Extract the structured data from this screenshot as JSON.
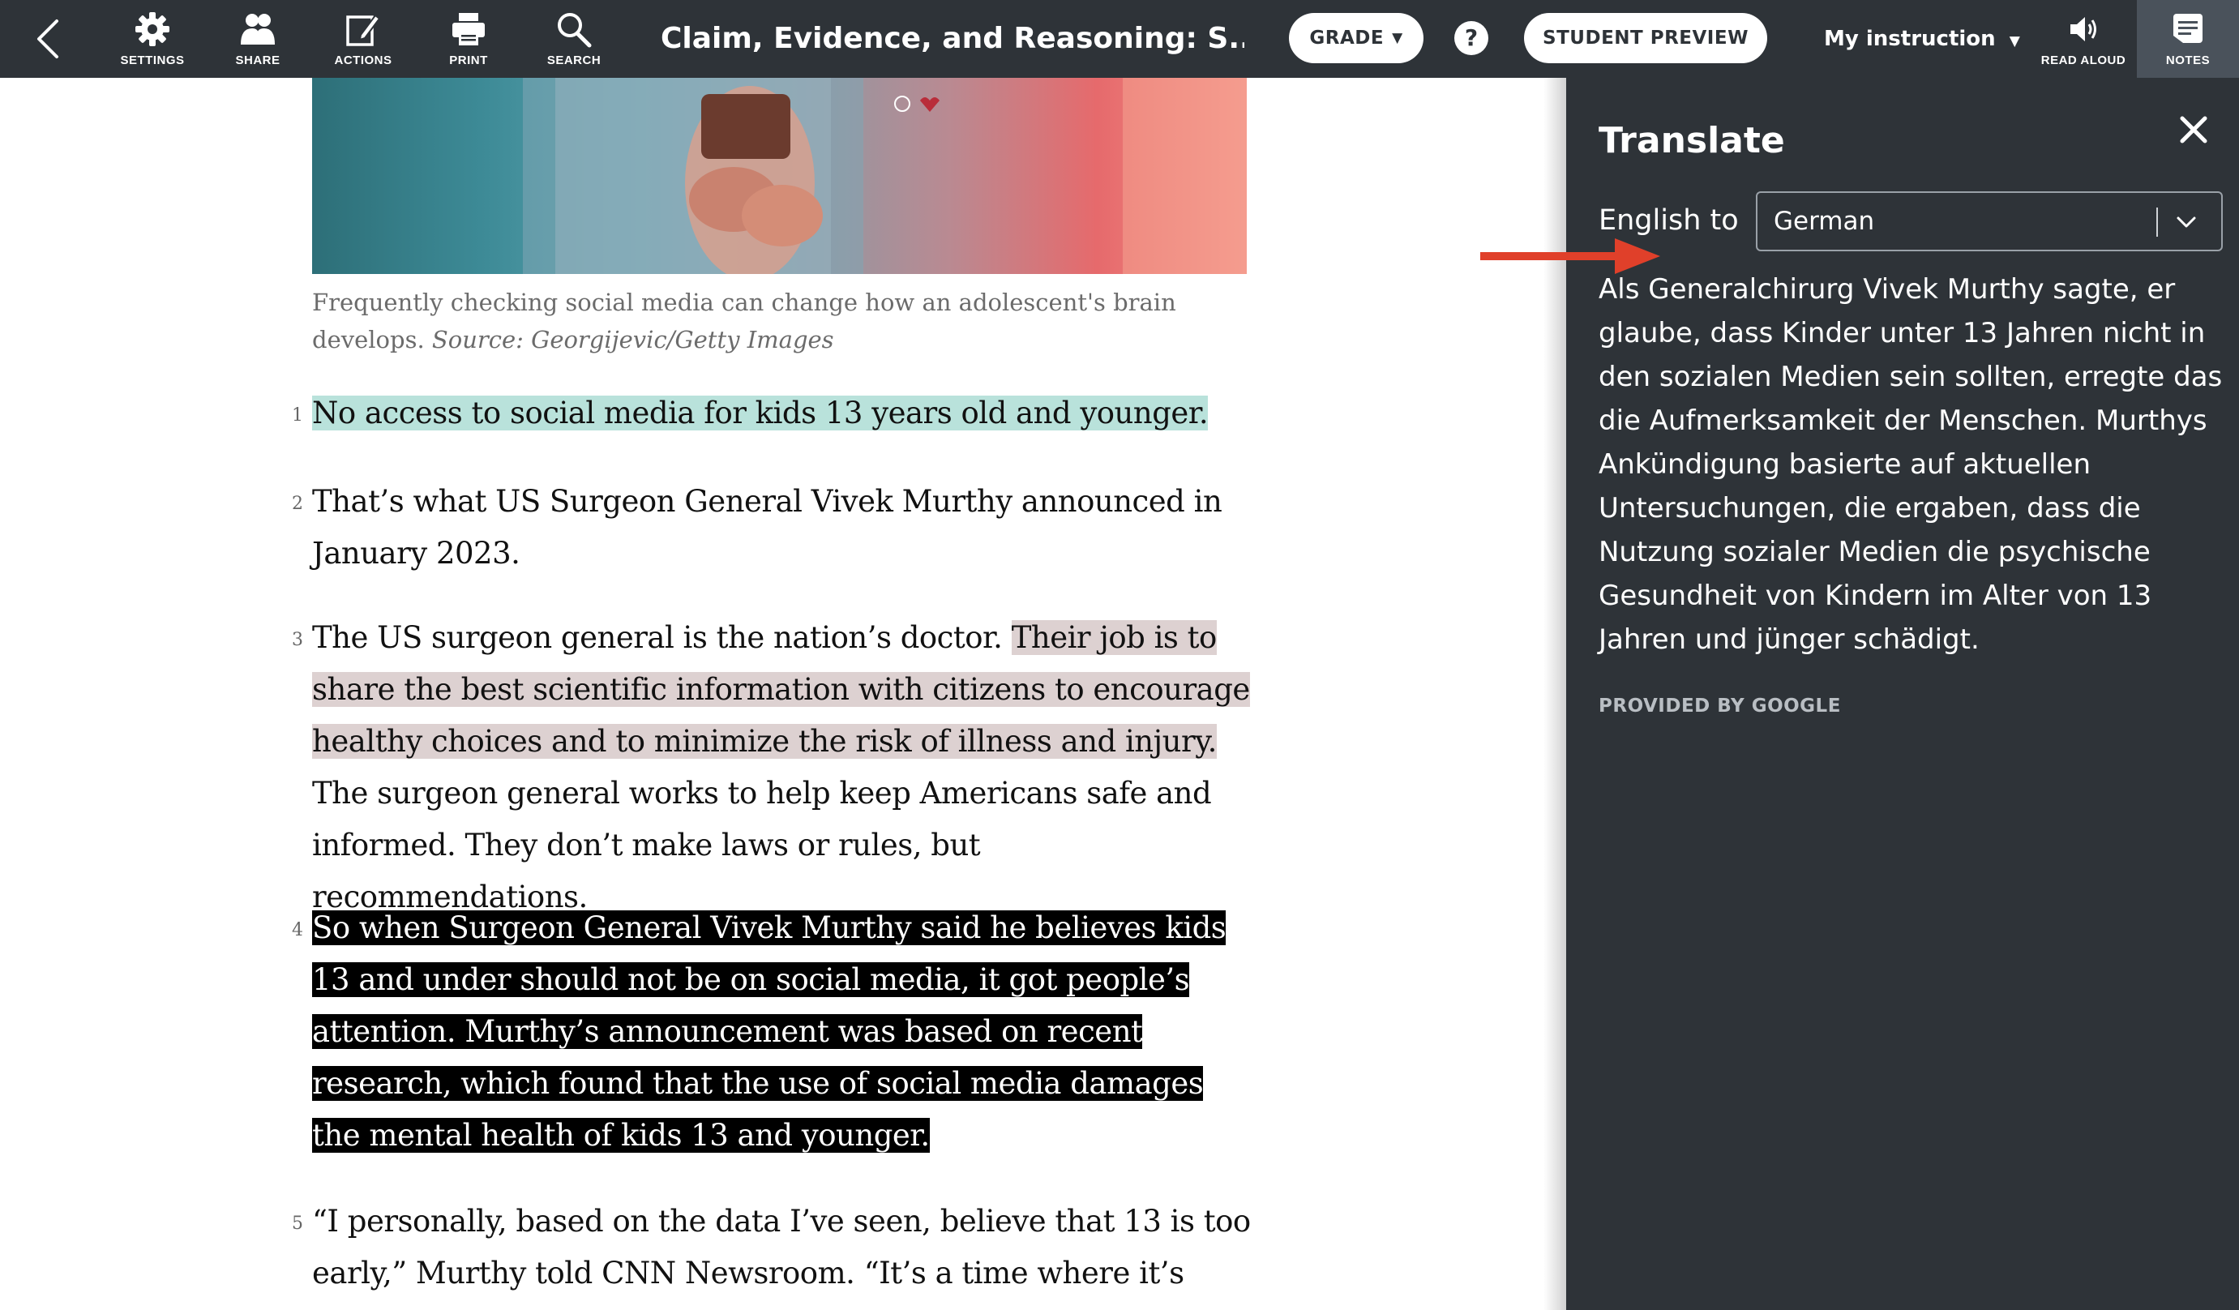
{
  "toolbar": {
    "back_icon": "chevron-left-icon",
    "buttons": [
      {
        "label": "SETTINGS",
        "icon": "gear-icon"
      },
      {
        "label": "SHARE",
        "icon": "people-icon"
      },
      {
        "label": "ACTIONS",
        "icon": "edit-icon"
      },
      {
        "label": "PRINT",
        "icon": "printer-icon"
      },
      {
        "label": "SEARCH",
        "icon": "search-icon"
      }
    ],
    "title": "Claim, Evidence, and Reasoning: S...",
    "grade_label": "GRADE",
    "help_label": "?",
    "student_preview_label": "STUDENT PREVIEW",
    "instruction_label": "My instruction",
    "read_aloud_label": "READ ALOUD",
    "notes_label": "NOTES"
  },
  "article": {
    "image_caption": "Frequently checking social media can change how an adolescent's brain develops.",
    "image_source": "Source: Georgijevic/Getty Images",
    "paragraphs": [
      {
        "num": "1",
        "text": "No access to social media for kids 13 years old and younger."
      },
      {
        "num": "2",
        "text": "That’s what US Surgeon General Vivek Murthy announced in January 2023."
      },
      {
        "num": "3",
        "text_a": "The US surgeon general is the nation’s doctor. ",
        "text_b": "Their job is to share the best scientific information with citizens to encourage healthy choices and to minimize the risk of illness and injury.",
        "text_c": " The surgeon general works to help keep Americans safe and informed. They don’t make laws or rules, but recommendations."
      },
      {
        "num": "4",
        "text": "So when Surgeon General Vivek Murthy said he believes kids 13 and under should not be on social media, it got people’s attention. Murthy’s announcement was based on recent research, which found that the use of social media damages the mental health of kids 13 and younger."
      },
      {
        "num": "5",
        "text": "“I personally, based on the data I’ve seen, believe that 13 is too early,” Murthy told CNN Newsroom. “It’s a time where it’s really"
      }
    ]
  },
  "translate": {
    "title": "Translate",
    "from_label": "English to",
    "language": "German",
    "translation": "Als Generalchirurg Vivek Murthy sagte, er glaube, dass Kinder unter 13 Jahren nicht in den sozialen Medien sein sollten, erregte das die Aufmerksamkeit der Menschen. Murthys Ankündigung basierte auf aktuellen Untersuchungen, die ergaben, dass die Nutzung sozialer Medien die psychische Gesundheit von Kindern im Alter von 13 Jahren und jünger schädigt.",
    "provided_by": "PROVIDED BY GOOGLE"
  },
  "colors": {
    "toolbar_bg": "#2e3338",
    "highlight_teal": "#b9e2db",
    "highlight_rose": "#ddd1d1",
    "highlight_black": "#000000",
    "annotation_arrow": "#e0402a"
  }
}
